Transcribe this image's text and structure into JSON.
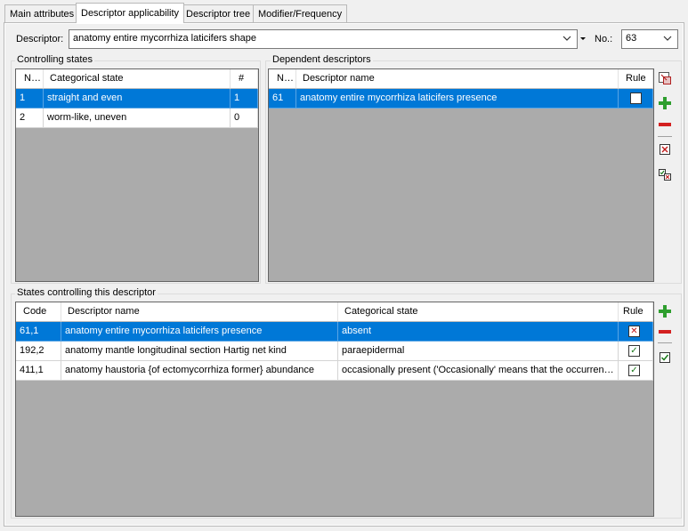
{
  "tabs": [
    {
      "label": "Main attributes"
    },
    {
      "label": "Descriptor applicability"
    },
    {
      "label": "Descriptor tree"
    },
    {
      "label": "Modifier/Frequency"
    }
  ],
  "descriptor": {
    "label": "Descriptor:",
    "value": "anatomy entire mycorrhiza laticifers shape",
    "no_label": "No.:",
    "no_value": "63"
  },
  "controlling_states": {
    "title": "Controlling states",
    "columns": {
      "no": "No.",
      "state": "Categorical state",
      "count": "#"
    },
    "rows": [
      {
        "no": "1",
        "state": "straight and even",
        "count": "1"
      },
      {
        "no": "2",
        "state": "worm-like, uneven",
        "count": "0"
      }
    ]
  },
  "dependent_descriptors": {
    "title": "Dependent descriptors",
    "columns": {
      "no": "No.",
      "name": "Descriptor name",
      "rule": "Rule"
    },
    "rows": [
      {
        "no": "61",
        "name": "anatomy entire mycorrhiza laticifers presence",
        "rule_glyph": "✓"
      }
    ]
  },
  "states_controlling": {
    "title": "States controlling this descriptor",
    "columns": {
      "code": "Code",
      "name": "Descriptor name",
      "state": "Categorical state",
      "rule": "Rule"
    },
    "rows": [
      {
        "code": "61,1",
        "name": "anatomy entire mycorrhiza laticifers presence",
        "state": "absent",
        "rule_glyph": "✕"
      },
      {
        "code": "192,2",
        "name": "anatomy mantle longitudinal section Hartig net kind",
        "state": "paraepidermal",
        "rule_glyph": "✓"
      },
      {
        "code": "411,1",
        "name": "anatomy haustoria {of ectomycorrhiza former} abundance",
        "state": "occasionally present ('Occasionally' means that the occurrence is not regular but may also be on mor...",
        "rule_glyph": "✓"
      }
    ]
  },
  "colors": {
    "selection": "#0078d7",
    "grid_bg": "#ababab",
    "add": "#2e9e2e",
    "remove": "#d42020"
  },
  "icons": [
    "dropdown-chevron-icon",
    "split-dropdown-icon",
    "link-icon",
    "add-icon",
    "remove-icon",
    "clear-rule-icon",
    "switch-rule-icon",
    "check-rule-icon"
  ]
}
